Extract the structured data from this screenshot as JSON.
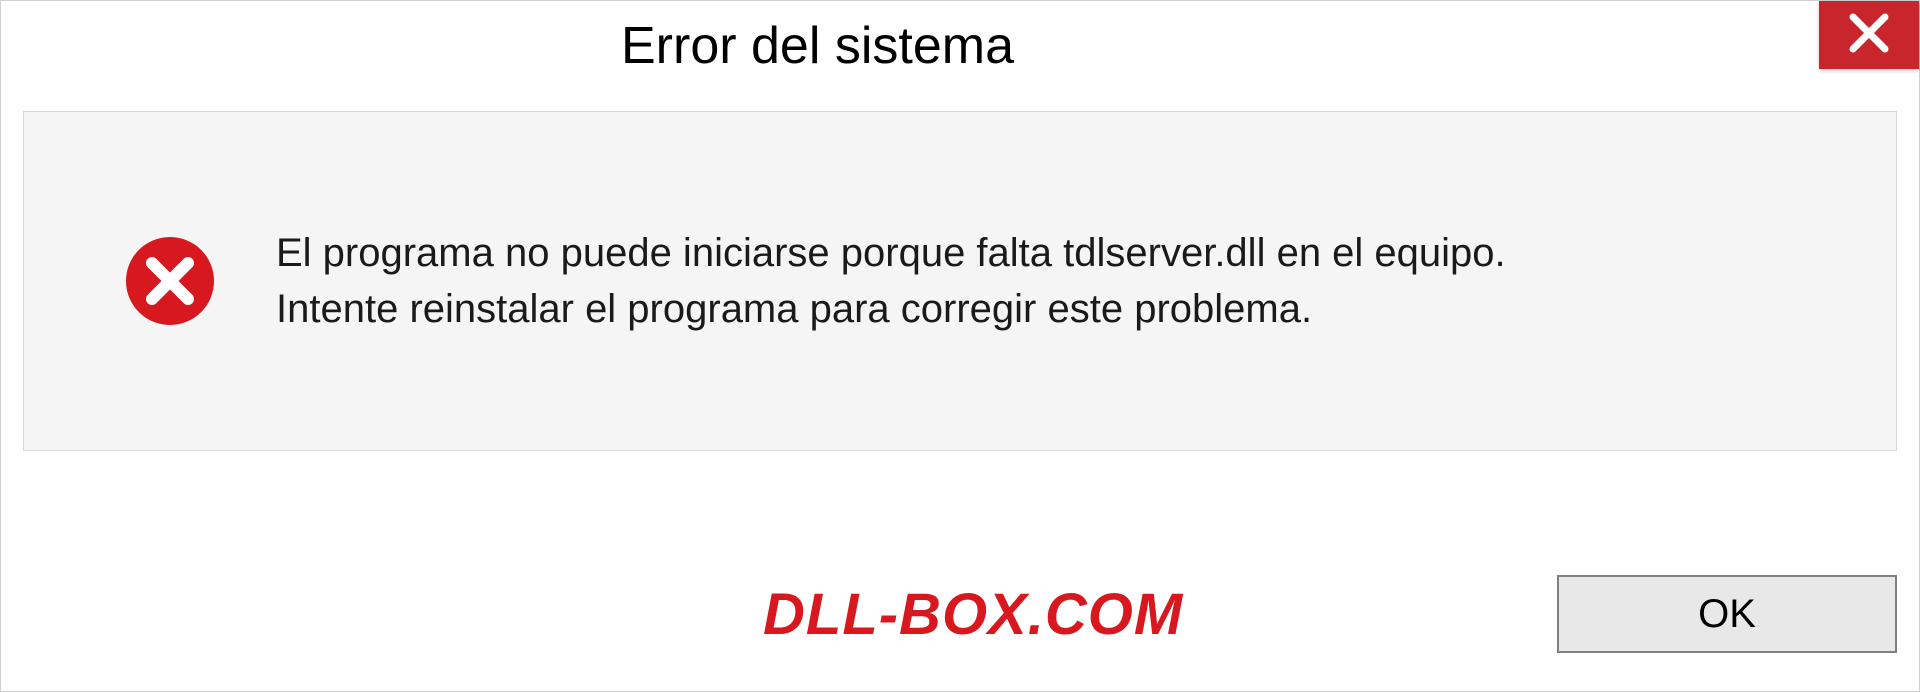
{
  "dialog": {
    "title": "Error del sistema",
    "message_line1": "El programa no puede iniciarse porque falta tdlserver.dll en el equipo.",
    "message_line2": "Intente reinstalar el programa para corregir este problema.",
    "ok_label": "OK"
  },
  "watermark": "DLL-BOX.COM",
  "colors": {
    "close_button": "#c9252d",
    "error_icon": "#d8181f",
    "watermark": "#d8181f"
  }
}
